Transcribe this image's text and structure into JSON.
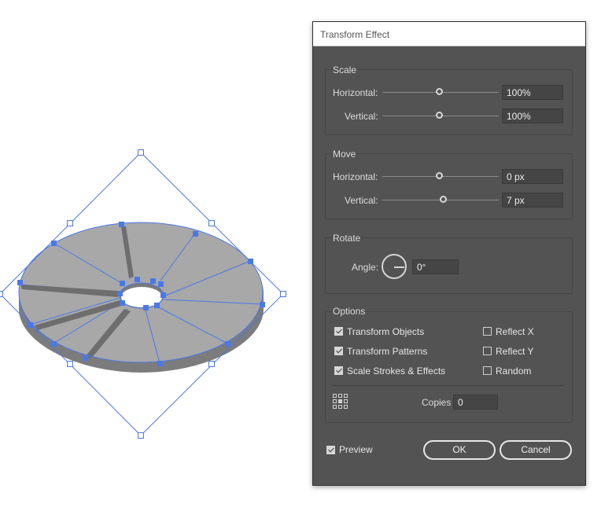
{
  "dialog": {
    "title": "Transform Effect",
    "scale": {
      "label": "Scale",
      "horizontal_label": "Horizontal:",
      "horizontal_value": "100%",
      "vertical_label": "Vertical:",
      "vertical_value": "100%"
    },
    "move": {
      "label": "Move",
      "horizontal_label": "Horizontal:",
      "horizontal_value": "0 px",
      "vertical_label": "Vertical:",
      "vertical_value": "7 px"
    },
    "rotate": {
      "label": "Rotate",
      "angle_label": "Angle:",
      "angle_value": "0°"
    },
    "options": {
      "label": "Options",
      "transform_objects": {
        "label": "Transform Objects",
        "checked": true
      },
      "transform_patterns": {
        "label": "Transform Patterns",
        "checked": true
      },
      "scale_strokes": {
        "label": "Scale Strokes & Effects",
        "checked": true
      },
      "reflect_x": {
        "label": "Reflect X",
        "checked": false
      },
      "reflect_y": {
        "label": "Reflect Y",
        "checked": false
      },
      "random": {
        "label": "Random",
        "checked": false
      },
      "copies_label": "Copies",
      "copies_value": "0"
    },
    "preview": {
      "label": "Preview",
      "checked": true
    },
    "ok_label": "OK",
    "cancel_label": "Cancel"
  },
  "colors": {
    "dialog_bg": "#535353",
    "selection_blue": "#4a78e6",
    "shape_fill": "#a8a8a8",
    "shape_side": "#7c7c7c"
  }
}
